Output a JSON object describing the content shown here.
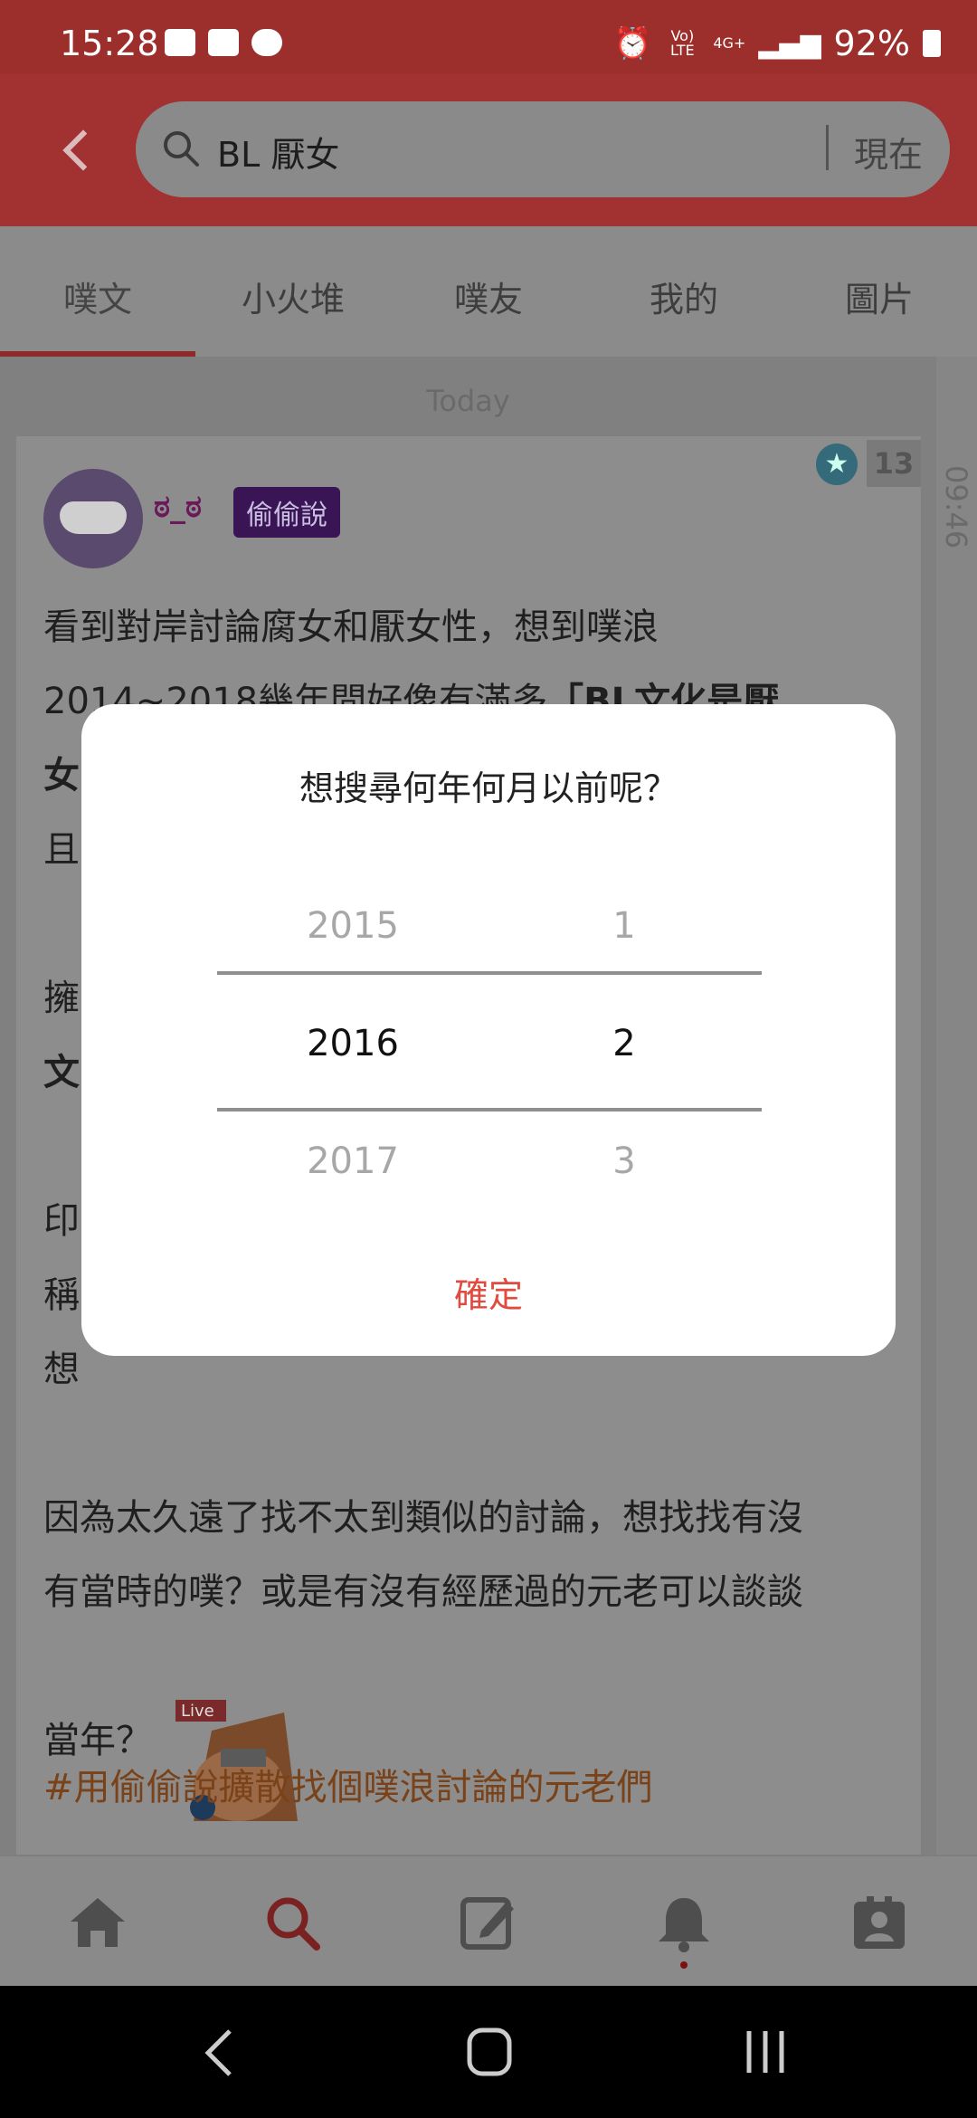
{
  "status_bar": {
    "time": "15:28",
    "battery": "92%",
    "network": "4G+",
    "volte": "Vo) LTE"
  },
  "search": {
    "query": "BL 厭女",
    "time_filter": "現在"
  },
  "tabs": [
    "噗文",
    "小火堆",
    "噗友",
    "我的",
    "圖片"
  ],
  "timeline": {
    "date_label": "Today",
    "side_time": "09:46"
  },
  "post": {
    "username": "ಠ_ಠ",
    "tag": "偷偷說",
    "response_count": "13",
    "text": {
      "line1": "看到對岸討論腐女和厭女性，想到噗浪",
      "line2_a": "2014~2018幾年間好像有滿多",
      "line2_b": "「BL文化是厭",
      "line3": "女",
      "line4": "且",
      "line5": "擁",
      "line6": "文",
      "line7": "印",
      "line8": "稱",
      "line9": "想",
      "para2_line1": "因為太久遠了找不太到類似的討論，想找找有沒",
      "para2_line2": "有當時的噗？或是有沒有經歷過的元老可以談談",
      "para3": "當年？"
    },
    "sticker_label": "Live",
    "hashtag": "#用偷偷說擴散找個噗浪討論的元老們"
  },
  "dialog": {
    "title": "想搜尋何年何月以前呢？",
    "years": {
      "prev": "2015",
      "selected": "2016",
      "next": "2017"
    },
    "months": {
      "prev": "1",
      "selected": "2",
      "next": "3"
    },
    "confirm": "確定"
  },
  "bottom_nav": [
    "home-icon",
    "search-icon",
    "edit-icon",
    "bell-icon",
    "profile-icon"
  ],
  "colors": {
    "accent": "#e04a3f",
    "appbar": "#a23231",
    "tag_bg": "#3a1556"
  }
}
